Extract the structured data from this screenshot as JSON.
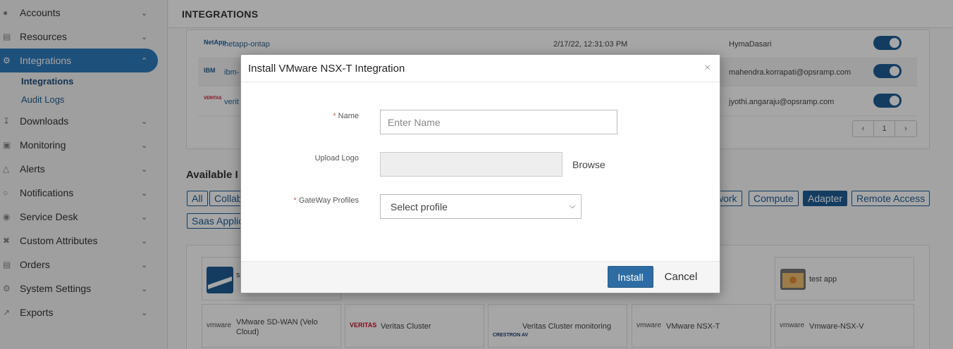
{
  "sidebar": {
    "items": [
      {
        "label": "Accounts",
        "icon": "user-icon"
      },
      {
        "label": "Resources",
        "icon": "list-icon"
      },
      {
        "label": "Integrations",
        "icon": "plug-icon"
      },
      {
        "label": "Downloads",
        "icon": "download-icon"
      },
      {
        "label": "Monitoring",
        "icon": "monitor-icon"
      },
      {
        "label": "Alerts",
        "icon": "warning-icon"
      },
      {
        "label": "Notifications",
        "icon": "bell-icon"
      },
      {
        "label": "Service Desk",
        "icon": "headset-icon"
      },
      {
        "label": "Custom Attributes",
        "icon": "tools-icon"
      },
      {
        "label": "Orders",
        "icon": "cart-icon"
      },
      {
        "label": "System Settings",
        "icon": "gear-icon"
      },
      {
        "label": "Exports",
        "icon": "export-icon"
      }
    ],
    "subitems": [
      "Integrations",
      "Audit Logs"
    ],
    "accent": "#2e7cbf"
  },
  "header": {
    "title": "INTEGRATIONS"
  },
  "installed_table": {
    "rows": [
      {
        "logo": "NetApp",
        "name": "netapp-ontap",
        "date": "2/17/22, 12:31:03 PM",
        "user": "HymaDasari"
      },
      {
        "logo": "IBM",
        "name": "ibm-",
        "date": "",
        "user": "mahendra.korrapati@opsramp.com"
      },
      {
        "logo": "VERITAS",
        "name": "verit",
        "date": "",
        "user": "jyothi.angaraju@opsramp.com"
      }
    ],
    "pager": {
      "prev": "‹",
      "page": "1",
      "next": "›"
    }
  },
  "available": {
    "title": "Available I",
    "tags": [
      "All",
      "Collab",
      "work",
      "Compute",
      "Adapter",
      "Remote Access",
      "Saas Applic"
    ],
    "active_tag": "Adapter",
    "cards": [
      {
        "logo": "",
        "label": "s"
      },
      {
        "logo": "",
        "label": "test app"
      },
      {
        "logo": "vmware",
        "label": "VMware SD-WAN (Velo Cloud)"
      },
      {
        "logo": "VERITAS",
        "label": "Veritas Cluster"
      },
      {
        "logo": "CRESTRON AV",
        "label": "Veritas Cluster monitoring"
      },
      {
        "logo": "vmware",
        "label": "VMware NSX-T"
      },
      {
        "logo": "vmware",
        "label": "Vmware-NSX-V"
      }
    ]
  },
  "modal": {
    "title": "Install VMware NSX-T Integration",
    "close": "×",
    "name_label": "Name",
    "name_placeholder": "Enter Name",
    "name_value": "",
    "logo_label": "Upload Logo",
    "browse_label": "Browse",
    "gateway_label": "GateWay Profiles",
    "gateway_selected": "Select profile",
    "required_mark": "*",
    "install_label": "Install",
    "cancel_label": "Cancel"
  }
}
